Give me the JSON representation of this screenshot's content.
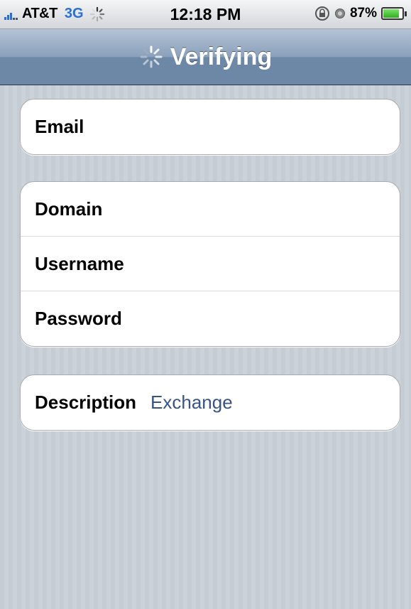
{
  "status_bar": {
    "carrier": "AT&T",
    "network": "3G",
    "time": "12:18 PM",
    "battery_percent": "87%",
    "battery_level": 0.87,
    "icons": [
      "signal-icon",
      "network-activity-icon",
      "orientation-lock-icon",
      "alarm-icon",
      "battery-icon"
    ]
  },
  "nav_bar": {
    "title": "Verifying",
    "icon": "spinner-icon"
  },
  "form": {
    "email_label": "Email",
    "domain_label": "Domain",
    "username_label": "Username",
    "password_label": "Password",
    "description_label": "Description",
    "description_value": "Exchange"
  },
  "colors": {
    "accent_value_text": "#385487",
    "nav_bar": "#6d87a7",
    "network_text": "#2a6fd6"
  }
}
